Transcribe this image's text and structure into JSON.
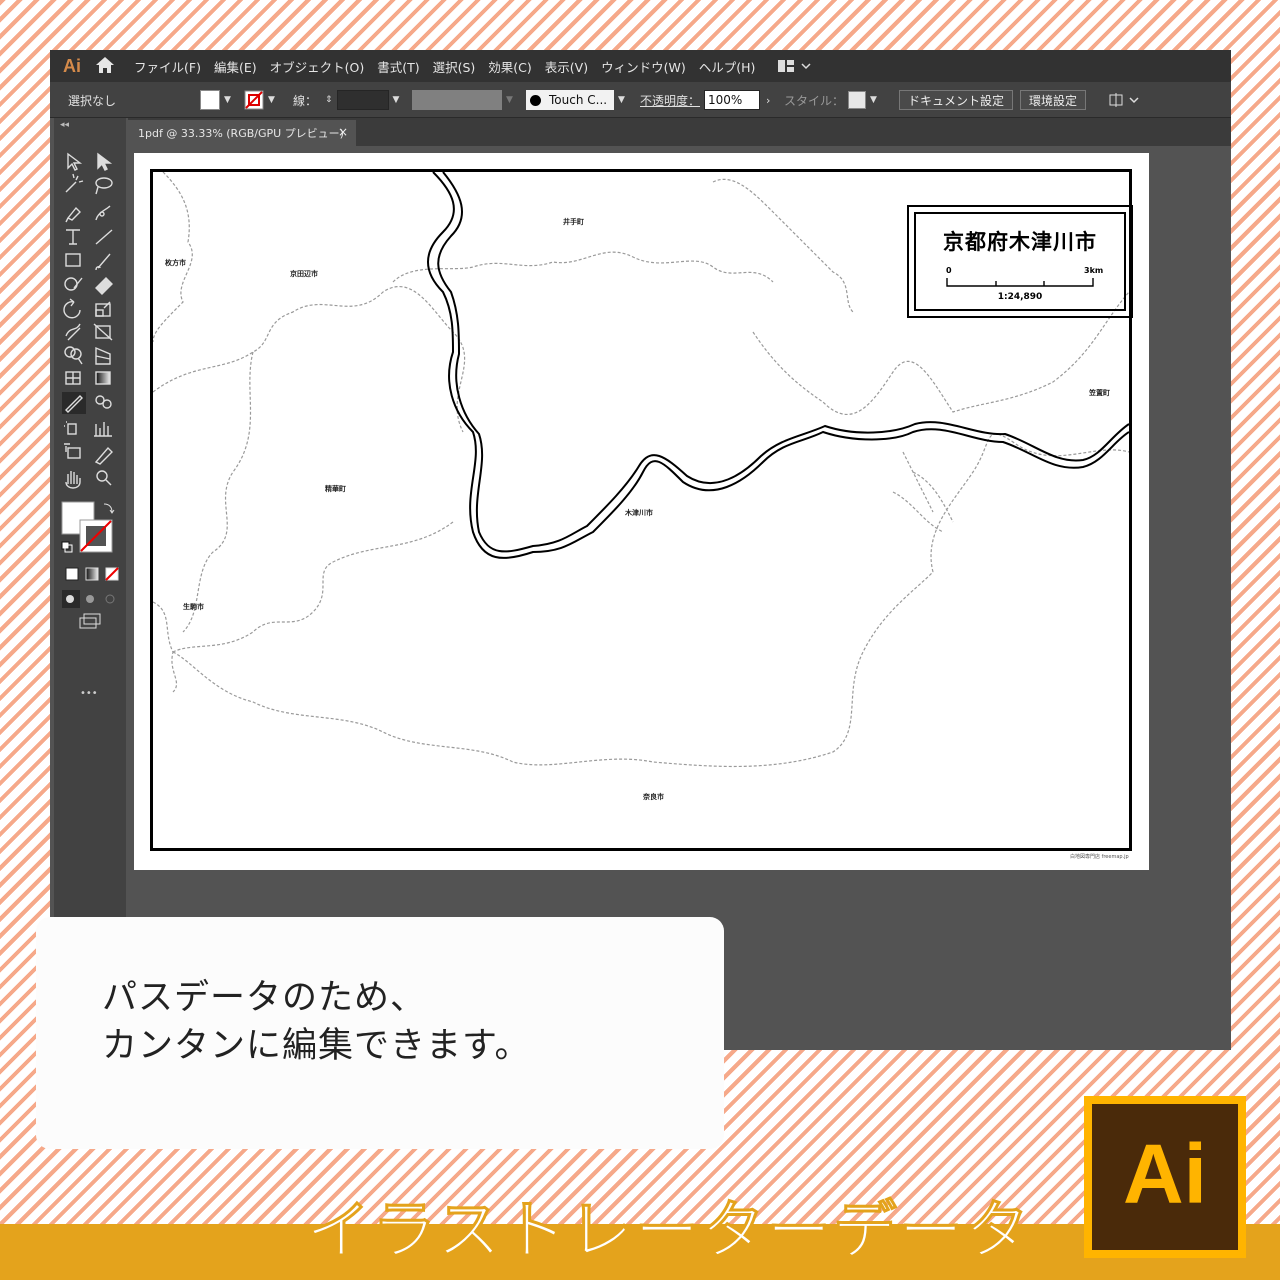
{
  "app": {
    "logo_text": "Ai",
    "menu": [
      "ファイル(F)",
      "編集(E)",
      "オブジェクト(O)",
      "書式(T)",
      "選択(S)",
      "効果(C)",
      "表示(V)",
      "ウィンドウ(W)",
      "ヘルプ(H)"
    ]
  },
  "controlbar": {
    "selection": "選択なし",
    "stroke_label": "線：",
    "brush_label": "Touch C...",
    "opacity_label": "不透明度：",
    "opacity_value": "100%",
    "style_label": "スタイル：",
    "document_setup": "ドキュメント設定",
    "preferences": "環境設定"
  },
  "tab": {
    "title": "1pdf @ 33.33% (RGB/GPU プレビュー)",
    "close": "×"
  },
  "toolpanel": {
    "collapse": "◂◂",
    "more": "•••"
  },
  "map": {
    "title": "京都府木津川市",
    "scale_start": "0",
    "scale_end": "3km",
    "scale_ratio": "1:24,890",
    "credit": "白地図専門店 freemap.jp",
    "places": [
      {
        "name": "井手町"
      },
      {
        "name": "枚方市"
      },
      {
        "name": "京田辺市"
      },
      {
        "name": "笠置町"
      },
      {
        "name": "精華町"
      },
      {
        "name": "木津川市"
      },
      {
        "name": "生駒市"
      },
      {
        "name": "奈良市"
      }
    ]
  },
  "callout": {
    "line1": "パスデータのため、",
    "line2": "カンタンに編集できます。"
  },
  "banner": {
    "title": "イラストレーターデータ",
    "badge": "Ai"
  },
  "colors": {
    "stripe": "#f6a98a",
    "band": "#e4a31c",
    "badge_border": "#ffb400",
    "badge_bg": "#4a2a0a"
  }
}
